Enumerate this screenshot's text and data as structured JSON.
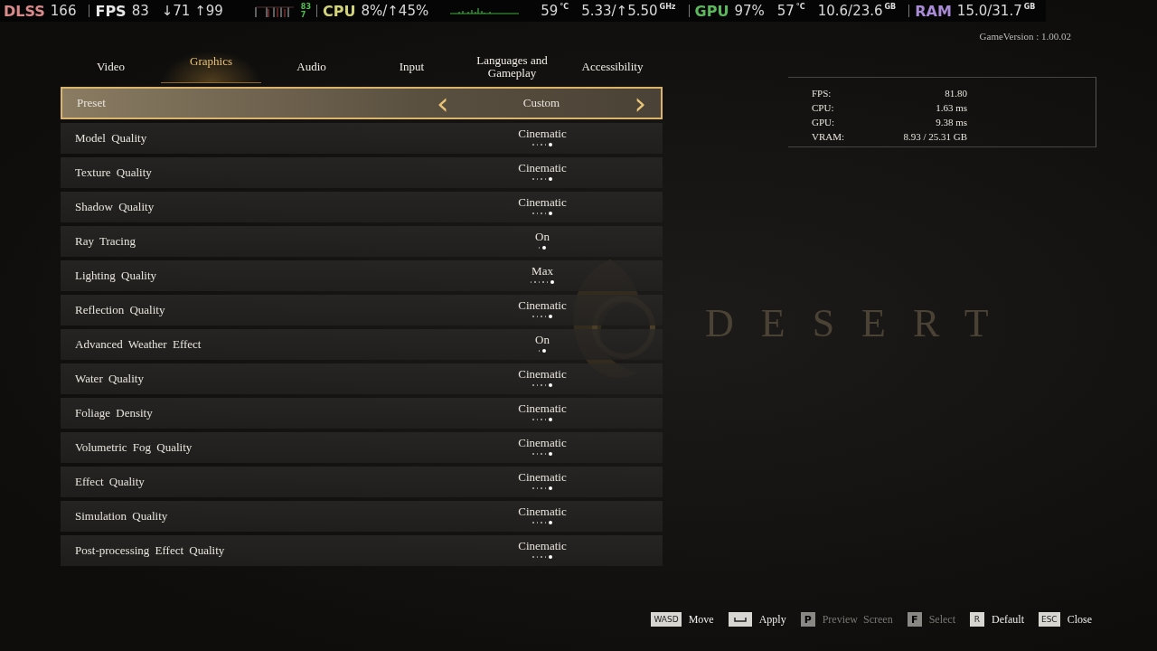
{
  "overlay": [
    {
      "kind": "label",
      "text": "DLSS",
      "color": "#d98a8a"
    },
    {
      "kind": "value",
      "text": "166"
    },
    {
      "kind": "sep"
    },
    {
      "kind": "label",
      "text": "FPS",
      "color": "#e6e6e6"
    },
    {
      "kind": "value",
      "text": "83"
    },
    {
      "kind": "value",
      "text": "↓71 ↑99"
    },
    {
      "kind": "bars"
    },
    {
      "kind": "mini",
      "text": "83",
      "color": "#4fc04f"
    },
    {
      "kind": "sep"
    },
    {
      "kind": "label",
      "text": "CPU",
      "color": "#d2d27a"
    },
    {
      "kind": "value",
      "text": "8%/↑45%"
    },
    {
      "kind": "spark"
    },
    {
      "kind": "value",
      "text": "59"
    },
    {
      "kind": "unit",
      "text": "°C"
    },
    {
      "kind": "value",
      "text": "5.33/↑5.50"
    },
    {
      "kind": "unit",
      "text": "GHz"
    },
    {
      "kind": "sep"
    },
    {
      "kind": "label",
      "text": "GPU",
      "color": "#5cb85c"
    },
    {
      "kind": "value",
      "text": "97%"
    },
    {
      "kind": "value",
      "text": "57"
    },
    {
      "kind": "unit",
      "text": "°C"
    },
    {
      "kind": "value",
      "text": "10.6/23.6"
    },
    {
      "kind": "unit",
      "text": "GB"
    },
    {
      "kind": "sep"
    },
    {
      "kind": "label",
      "text": "RAM",
      "color": "#a98bd6"
    },
    {
      "kind": "value",
      "text": "15.0/31.7"
    },
    {
      "kind": "unit",
      "text": "GB"
    }
  ],
  "overlay_mini_low": "7",
  "game_version": "GameVersion : 1.00.02",
  "tabs": [
    {
      "label": "Video",
      "selected": false
    },
    {
      "label": "Graphics",
      "selected": true
    },
    {
      "label": "Audio",
      "selected": false
    },
    {
      "label": "Input",
      "selected": false
    },
    {
      "label": "Languages and Gameplay",
      "selected": false
    },
    {
      "label": "Accessibility",
      "selected": false
    }
  ],
  "preset": {
    "label": "Preset",
    "value": "Custom",
    "prev": "‹",
    "next": "›"
  },
  "settings": [
    {
      "label": "Model Quality",
      "value": "Cinematic",
      "dots": [
        false,
        false,
        false,
        false,
        true
      ]
    },
    {
      "label": "Texture Quality",
      "value": "Cinematic",
      "dots": [
        false,
        false,
        false,
        false,
        true
      ]
    },
    {
      "label": "Shadow Quality",
      "value": "Cinematic",
      "dots": [
        false,
        false,
        false,
        false,
        true
      ]
    },
    {
      "label": "Ray Tracing",
      "value": "On",
      "dots": [
        false,
        true
      ]
    },
    {
      "label": "Lighting Quality",
      "value": "Max",
      "dots": [
        false,
        false,
        false,
        false,
        false,
        true
      ]
    },
    {
      "label": "Reflection Quality",
      "value": "Cinematic",
      "dots": [
        false,
        false,
        false,
        false,
        true
      ]
    },
    {
      "label": "Advanced Weather Effect",
      "value": "On",
      "dots": [
        false,
        true
      ]
    },
    {
      "label": "Water Quality",
      "value": "Cinematic",
      "dots": [
        false,
        false,
        false,
        false,
        true
      ]
    },
    {
      "label": "Foliage Density",
      "value": "Cinematic",
      "dots": [
        false,
        false,
        false,
        false,
        true
      ]
    },
    {
      "label": "Volumetric Fog Quality",
      "value": "Cinematic",
      "dots": [
        false,
        false,
        false,
        false,
        true
      ]
    },
    {
      "label": "Effect Quality",
      "value": "Cinematic",
      "dots": [
        false,
        false,
        false,
        false,
        true
      ]
    },
    {
      "label": "Simulation Quality",
      "value": "Cinematic",
      "dots": [
        false,
        false,
        false,
        false,
        true
      ]
    },
    {
      "label": "Post-processing Effect Quality",
      "value": "Cinematic",
      "dots": [
        false,
        false,
        false,
        false,
        true
      ]
    }
  ],
  "stats": [
    {
      "label": "FPS:",
      "value": "81.80"
    },
    {
      "label": "CPU:",
      "value": "1.63 ms"
    },
    {
      "label": "GPU:",
      "value": "9.38 ms"
    },
    {
      "label": "VRAM:",
      "value": "8.93 / 25.31 GB"
    }
  ],
  "logo": {
    "right": "DESERT"
  },
  "hints": [
    {
      "kind": "text",
      "key": "WASD",
      "label": "Move",
      "disabled": false
    },
    {
      "kind": "space",
      "label": "Apply",
      "disabled": false
    },
    {
      "kind": "text",
      "key": "P",
      "label": "Preview Screen",
      "disabled": true
    },
    {
      "kind": "text",
      "key": "F",
      "label": "Select",
      "disabled": true
    },
    {
      "kind": "text",
      "key": "R",
      "label": "Default",
      "disabled": false
    },
    {
      "kind": "text",
      "key": "ESC",
      "label": "Close",
      "disabled": false
    }
  ]
}
